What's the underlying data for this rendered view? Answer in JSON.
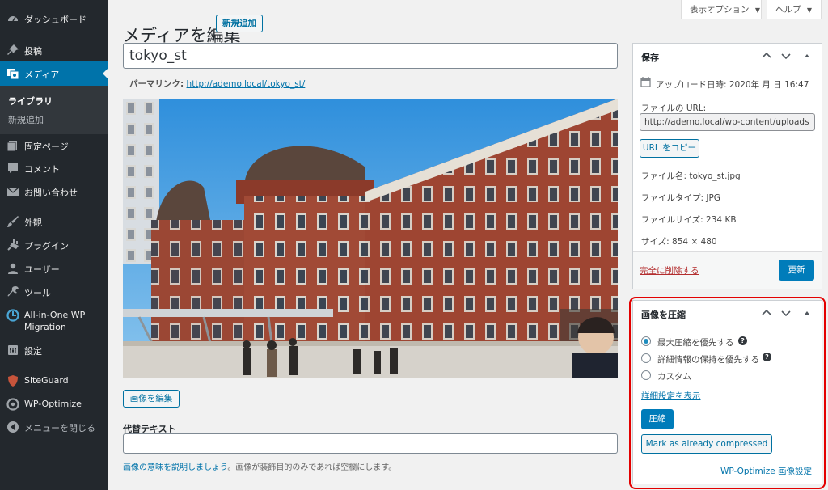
{
  "sidebar": {
    "items": [
      {
        "label": "ダッシュボード",
        "icon": "dashboard-icon"
      },
      {
        "label": "投稿",
        "icon": "pushpin-icon"
      },
      {
        "label": "メディア",
        "icon": "media-icon"
      },
      {
        "label": "固定ページ",
        "icon": "page-icon"
      },
      {
        "label": "コメント",
        "icon": "comment-icon"
      },
      {
        "label": "お問い合わせ",
        "icon": "mail-icon"
      },
      {
        "label": "外観",
        "icon": "brush-icon"
      },
      {
        "label": "プラグイン",
        "icon": "plugin-icon"
      },
      {
        "label": "ユーザー",
        "icon": "user-icon"
      },
      {
        "label": "ツール",
        "icon": "wrench-icon"
      },
      {
        "label": "All-in-One WP",
        "label2": "Migration",
        "icon": "migration-icon"
      },
      {
        "label": "設定",
        "icon": "settings-icon"
      },
      {
        "label": "SiteGuard",
        "icon": "siteguard-icon"
      },
      {
        "label": "WP-Optimize",
        "icon": "wp-optimize-icon"
      },
      {
        "label": "メニューを閉じる",
        "icon": "collapse-icon"
      }
    ],
    "submenu": [
      "ライブラリ",
      "新規追加"
    ]
  },
  "header": {
    "screen_options": "表示オプション",
    "help": "ヘルプ",
    "title": "メディアを編集",
    "add_new": "新規追加"
  },
  "media": {
    "title_value": "tokyo_st",
    "permalink_label": "パーマリンク:",
    "permalink_url": "http://ademo.local/tokyo_st/",
    "edit_image": "画像を編集",
    "alt_label": "代替テキスト",
    "alt_link": "画像の意味を説明しましょう",
    "alt_desc": "。画像が装飾目的のみであれば空欄にします。"
  },
  "save_box": {
    "title": "保存",
    "uploaded": "アップロード日時: 2020年  月  日 16:47",
    "file_url_label": "ファイルの URL:",
    "file_url": "http://ademo.local/wp-content/uploads",
    "copy_url": "URL をコピー",
    "file_name": "ファイル名: tokyo_st.jpg",
    "file_type": "ファイルタイプ: JPG",
    "file_size": "ファイルサイズ: 234 KB",
    "dimensions": "サイズ: 854 × 480",
    "delete": "完全に削除する",
    "update": "更新"
  },
  "compress_box": {
    "title": "画像を圧縮",
    "options": [
      "最大圧縮を優先する",
      "詳細情報の保持を優先する",
      "カスタム"
    ],
    "selected": 0,
    "show_advanced": "詳細設定を表示",
    "compress": "圧縮",
    "mark_compressed": "Mark as already compressed",
    "settings_link": "WP-Optimize 画像設定"
  },
  "colors": {
    "sidebar_bg": "#23282d",
    "active": "#0073aa",
    "primary": "#007cba",
    "highlight": "#e30000"
  }
}
